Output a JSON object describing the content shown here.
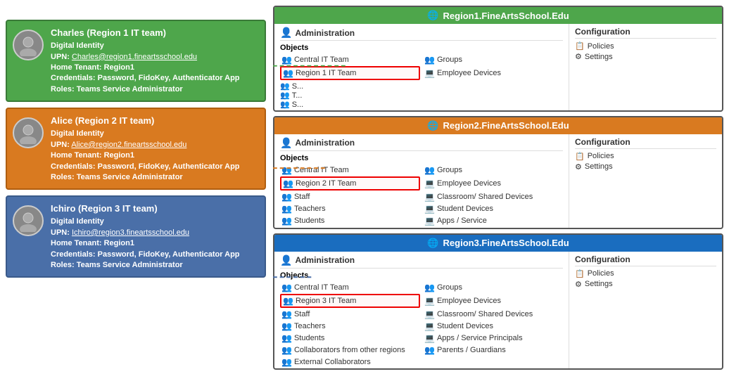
{
  "people": [
    {
      "name": "Charles (Region 1 IT team)",
      "color": "green",
      "upn": "Charles@region1.fineartsschool.edu",
      "homeTenant": "Region1",
      "credentials": "Password, FidoKey, Authenticator App",
      "roles": "Teams Service Administrator"
    },
    {
      "name": "Alice (Region 2 IT team)",
      "color": "orange",
      "upn": "Alice@region2.fineartsschool.edu",
      "homeTenant": "Region1",
      "credentials": "Password, FidoKey, Authenticator App",
      "roles": "Teams Service Administrator"
    },
    {
      "name": "Ichiro (Region 3 IT team)",
      "color": "blue-gray",
      "upn": "Ichiro@region3.fineartsschool.edu",
      "homeTenant": "Region1",
      "credentials": "Password, FidoKey, Authenticator App",
      "roles": "Teams Service Administrator"
    }
  ],
  "regions": [
    {
      "name": "Region1.FineArtsSchool.Edu",
      "color": "green",
      "objects": [
        {
          "label": "Central IT Team",
          "type": "people"
        },
        {
          "label": "Groups",
          "type": "group"
        },
        {
          "label": "Region 1 IT Team",
          "type": "people",
          "highlighted": true
        },
        {
          "label": "Employee Devices",
          "type": "device"
        }
      ],
      "admin_label": "Administration",
      "config_label": "Configuration",
      "config_items": [
        "Policies",
        "Settings"
      ]
    },
    {
      "name": "Region2.FineArtsSchool.Edu",
      "color": "orange",
      "objects": [
        {
          "label": "Central IT Team",
          "type": "people"
        },
        {
          "label": "Groups",
          "type": "group"
        },
        {
          "label": "Region 2 IT Team",
          "type": "people",
          "highlighted": true
        },
        {
          "label": "Employee Devices",
          "type": "device"
        },
        {
          "label": "Staff",
          "type": "people"
        },
        {
          "label": "Classroom/ Shared Devices",
          "type": "device"
        },
        {
          "label": "Teachers",
          "type": "people"
        },
        {
          "label": "Student Devices",
          "type": "device"
        },
        {
          "label": "Students",
          "type": "people"
        },
        {
          "label": "Apps / Service",
          "type": "device"
        }
      ],
      "admin_label": "Administration",
      "config_label": "Configuration",
      "config_items": [
        "Policies",
        "Settings"
      ]
    },
    {
      "name": "Region3.FineArtsSchool.Edu",
      "color": "blue",
      "objects": [
        {
          "label": "Central IT Team",
          "type": "people"
        },
        {
          "label": "Groups",
          "type": "group"
        },
        {
          "label": "Region 3 IT Team",
          "type": "people",
          "highlighted": true
        },
        {
          "label": "Employee Devices",
          "type": "device"
        },
        {
          "label": "Staff",
          "type": "people"
        },
        {
          "label": "Classroom/ Shared Devices",
          "type": "device"
        },
        {
          "label": "Teachers",
          "type": "people"
        },
        {
          "label": "Student Devices",
          "type": "device"
        },
        {
          "label": "Students",
          "type": "people"
        },
        {
          "label": "Apps / Service Principals",
          "type": "device"
        },
        {
          "label": "Collaborators from other regions",
          "type": "people"
        },
        {
          "label": "",
          "type": ""
        },
        {
          "label": "Parents / Guardians",
          "type": "people"
        },
        {
          "label": "",
          "type": ""
        },
        {
          "label": "External Collaborators",
          "type": "people"
        },
        {
          "label": "",
          "type": ""
        }
      ],
      "admin_label": "Administration",
      "config_label": "Configuration",
      "config_items": [
        "Policies",
        "Settings"
      ]
    }
  ],
  "labels": {
    "digital_identity": "Digital Identity",
    "upn_label": "UPN:",
    "home_tenant_label": "Home Tenant:",
    "credentials_label": "Credentials:",
    "roles_label": "Roles:",
    "objects_label": "Objects"
  }
}
